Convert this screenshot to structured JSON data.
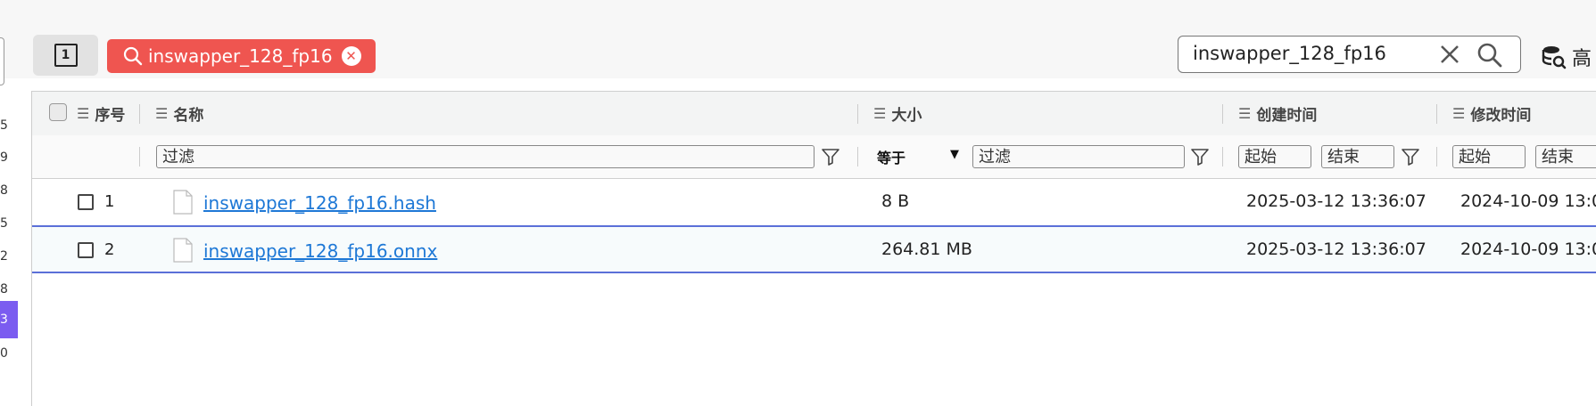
{
  "left_panel": {
    "numbers": [
      "5",
      "9",
      "8",
      "5",
      "2",
      "8",
      "3",
      "0"
    ],
    "active_index": 6
  },
  "toolbar": {
    "view_button_label": "1",
    "filter_tag": {
      "label": "inswapper_128_fp16",
      "close_glyph": "✕"
    },
    "search": {
      "value": "inswapper_128_fp16"
    },
    "advanced_label": "高"
  },
  "table": {
    "columns": {
      "index": "序号",
      "name": "名称",
      "size": "大小",
      "created": "创建时间",
      "modified": "修改时间"
    },
    "filters": {
      "name_placeholder": "过滤",
      "size_operator": "等于",
      "size_placeholder": "过滤",
      "created_start": "起始",
      "created_end": "结束",
      "modified_start": "起始",
      "modified_end": "结束"
    },
    "rows": [
      {
        "index": "1",
        "name": "inswapper_128_fp16.hash",
        "size": "8 B",
        "created": "2025-03-12 13:36:07",
        "modified": "2024-10-09 13:0"
      },
      {
        "index": "2",
        "name": "inswapper_128_fp16.onnx",
        "size": "264.81 MB",
        "created": "2025-03-12 13:36:07",
        "modified": "2024-10-09 13:0"
      }
    ]
  },
  "colors": {
    "tag_bg": "#ef5550",
    "accent_purple": "#7b5cf0",
    "link_blue": "#1e78d6",
    "row_separator": "#5b6fd8"
  },
  "icons": {
    "view": "square-one-icon",
    "tag": "search-icon",
    "tag_close": "close-circle-icon",
    "search_clear": "close-icon",
    "search_go": "search-icon",
    "advanced": "database-search-icon",
    "column": "list-icon",
    "filter": "funnel-icon",
    "file": "file-icon",
    "dropdown": "caret-down-icon"
  }
}
